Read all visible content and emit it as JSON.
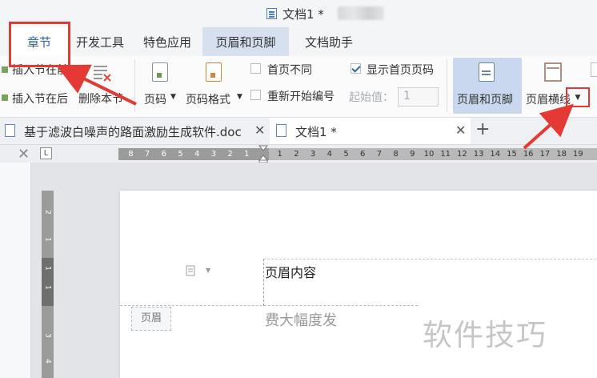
{
  "window": {
    "title": "文档1 *"
  },
  "menu_tabs": [
    {
      "label": "章节"
    },
    {
      "label": "开发工具"
    },
    {
      "label": "特色应用"
    },
    {
      "label": "页眉和页脚"
    },
    {
      "label": "文档助手"
    }
  ],
  "ribbon": {
    "insert_before": "插入节在前",
    "insert_after": "插入节在后",
    "delete_section": "删除本节",
    "page_number": "页码",
    "page_number_format": "页码格式",
    "first_page_different": "首页不同",
    "show_first_page_number": "显示首页页码",
    "restart_numbering": "重新开始编号",
    "start_value_label": "起始值：",
    "start_value": "1",
    "header_footer_button": "页眉和页脚",
    "header_horizontal_line": "页眉横线",
    "checks": {
      "first_page_different": false,
      "show_first_page_number": true,
      "restart_numbering": false
    }
  },
  "doc_tabs": [
    {
      "label": "基于滤波白噪声的路面激励生成软件.doc"
    },
    {
      "label": "文档1 *"
    }
  ],
  "ruler": {
    "h_ticks_left": [
      "8",
      "7",
      "6",
      "5",
      "4",
      "3",
      "2",
      "1"
    ],
    "h_ticks_right": [
      "1",
      "2",
      "3",
      "4",
      "5",
      "6",
      "7",
      "8",
      "9",
      "10",
      "11",
      "12",
      "13",
      "14",
      "15",
      "16",
      "17",
      "18",
      "19"
    ],
    "corner_label": "L",
    "v_ticks": [
      "2",
      "1",
      "1",
      "1",
      "3",
      "4"
    ]
  },
  "document": {
    "header_content": "页眉内容",
    "header_tag": "页眉",
    "body_text": "费大幅度发",
    "watermark": "软件技巧"
  },
  "colors": {
    "accent": "#2a5fb0",
    "annotation": "#e53935",
    "active_tab_bg": "#d6e0ef"
  }
}
